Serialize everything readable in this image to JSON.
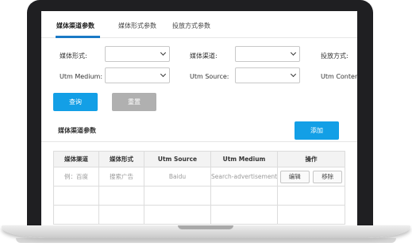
{
  "tabs": [
    {
      "label": "媒体渠道参数"
    },
    {
      "label": "媒体形式参数"
    },
    {
      "label": "投放方式参数"
    }
  ],
  "filters": {
    "media_form_label": "媒体形式:",
    "media_channel_label": "媒体渠道:",
    "delivery_method_label": "投放方式:",
    "utm_medium_label": "Utm Medium:",
    "utm_source_label": "Utm Source:",
    "utm_content_label": "Utm Content:"
  },
  "actions": {
    "query_label": "查询",
    "reset_label": "重置",
    "add_label": "添加"
  },
  "section": {
    "title": "媒体渠道参数"
  },
  "table": {
    "headers": [
      "媒体渠道",
      "媒体形式",
      "Utm Source",
      "Utm Medium",
      "操作"
    ],
    "rows": [
      {
        "channel": "例：百度",
        "form": "搜索广告",
        "source": "Baidu",
        "medium": "Search-advertisement",
        "edit": "编辑",
        "remove": "移除"
      }
    ]
  },
  "colors": {
    "accent": "#139fe6",
    "tab_underline": "#1a79c6",
    "secondary": "#b0b0b0"
  }
}
